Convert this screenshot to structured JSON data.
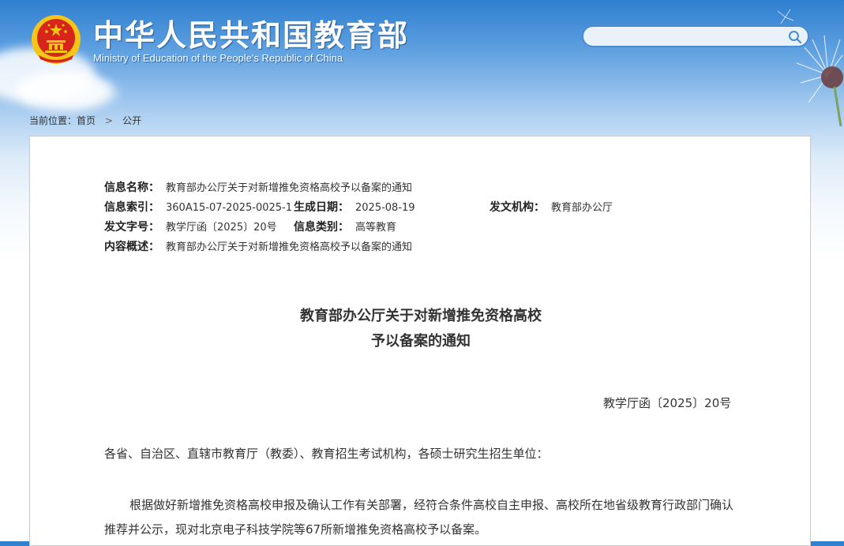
{
  "header": {
    "title": "中华人民共和国教育部",
    "subtitle": "Ministry of Education of the People's Republic of China",
    "search_placeholder": ""
  },
  "breadcrumb": {
    "prefix": "当前位置：",
    "items": [
      "首页",
      "公开"
    ],
    "separator": ">"
  },
  "meta": {
    "name_label": "信息名称：",
    "name_value": "教育部办公厅关于对新增推免资格高校予以备案的通知",
    "index_label": "信息索引：",
    "index_value": "360A15-07-2025-0025-1",
    "date_label": "生成日期：",
    "date_value": "2025-08-19",
    "issuer_label": "发文机构：",
    "issuer_value": "教育部办公厅",
    "docno_label": "发文字号：",
    "docno_value": "教学厅函〔2025〕20号",
    "category_label": "信息类别：",
    "category_value": "高等教育",
    "summary_label": "内容概述：",
    "summary_value": "教育部办公厅关于对新增推免资格高校予以备案的通知"
  },
  "document": {
    "title_line1": "教育部办公厅关于对新增推免资格高校",
    "title_line2": "予以备案的通知",
    "number": "教学厅函〔2025〕20号",
    "addressee": "各省、自治区、直辖市教育厅（教委）、教育招生考试机构，各硕士研究生招生单位：",
    "paragraph1": "根据做好新增推免资格高校申报及确认工作有关部署，经符合条件高校自主申报、高校所在地省级教育行政部门确认推荐并公示，现对北京电子科技学院等67所新增推免资格高校予以备案。"
  },
  "colors": {
    "header_blue": "#2f7fd0",
    "emblem_red": "#d8251b",
    "emblem_gold": "#f5c518"
  }
}
